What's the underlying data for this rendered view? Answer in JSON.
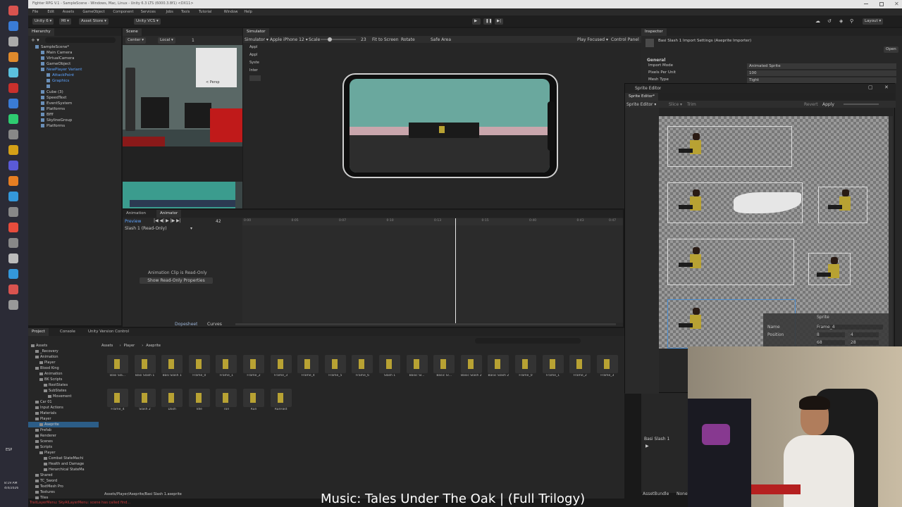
{
  "window": {
    "title": "Fighter RPG V.1 - SampleScene - Windows, Mac, Linux - Unity 6.3 LTS (6000.3.8f1) <DX11>"
  },
  "menubar": [
    "File",
    "Edit",
    "Assets",
    "GameObject",
    "Component",
    "Services",
    "Jobs",
    "Tools",
    "Tutorial",
    "Window",
    "Help"
  ],
  "toolbar": {
    "unity_label": "Unity 6",
    "account_label": "MI",
    "asset_store_label": "Asset Store",
    "vcs_label": "Unity VCS",
    "layout_label": "Layout"
  },
  "hierarchy": {
    "tab": "Hierarchy",
    "items": [
      {
        "label": "SampleScene*",
        "depth": 0,
        "expanded": true
      },
      {
        "label": "Main Camera",
        "depth": 1
      },
      {
        "label": "VirtualCamera",
        "depth": 1
      },
      {
        "label": "GameObject",
        "depth": 1
      },
      {
        "label": "NewPlayer Variant",
        "depth": 1,
        "expanded": true,
        "highlight": true
      },
      {
        "label": "AttackPoint",
        "depth": 2,
        "highlight": true
      },
      {
        "label": "Graphics",
        "depth": 2,
        "highlight": true
      },
      {
        "label": "",
        "depth": 2
      },
      {
        "label": "Cube (3)",
        "depth": 1
      },
      {
        "label": "SpeedText",
        "depth": 1
      },
      {
        "label": "EventSystem",
        "depth": 1
      },
      {
        "label": "Platforms",
        "depth": 1
      },
      {
        "label": "Bfff",
        "depth": 1
      },
      {
        "label": "SkylineGroup",
        "depth": 1
      },
      {
        "label": "Platforms",
        "depth": 1
      }
    ]
  },
  "scene": {
    "tab": "Scene",
    "center_label": "Center",
    "local_label": "Local",
    "persp_label": "< Persp",
    "count": "1"
  },
  "simulator": {
    "tab": "Simulator",
    "mode": "Simulator",
    "device": "Apple iPhone 12",
    "scale_label": "Scale",
    "scale_value": "23",
    "fit_label": "Fit to Screen",
    "rotate_label": "Rotate",
    "safe_area_label": "Safe Area",
    "play_mode": "Play Focused",
    "control_panel": "Control Panel",
    "side_items": [
      "Appl",
      "Appl",
      "Syste",
      "Inter"
    ]
  },
  "animation": {
    "tabs": [
      "Animation",
      "Animator"
    ],
    "preview_label": "Preview",
    "frame": "42",
    "clip": "Slash 1 (Read-Only)",
    "ruler": [
      "0:00",
      "0:05",
      "0:07",
      "0:10",
      "0:13",
      "0:15",
      "0:40",
      "0:43",
      "0:47"
    ],
    "readonly_text": "Animation Clip is Read-Only",
    "readonly_button": "Show Read-Only Properties",
    "bottom_tabs": [
      "Dopesheet",
      "Curves"
    ],
    "playhead_fraction": 0.56
  },
  "inspector": {
    "tab": "Inspector",
    "title": "Basi Slash 1 Import Settings (Aseprite Importer)",
    "open_button": "Open",
    "section": "General",
    "rows": [
      {
        "label": "Import Mode",
        "value": "Animated Sprite"
      },
      {
        "label": "Pixels Per Unit",
        "value": "100"
      },
      {
        "label": "Mesh Type",
        "value": "Tight"
      }
    ],
    "bottom_label": "Basi Slash 1",
    "bottom_tabs": [
      "AssetBundle",
      "None"
    ]
  },
  "sprite_editor": {
    "title": "Sprite Editor",
    "tab": "Sprite Editor*",
    "mode": "Sprite Editor",
    "slice_label": "Slice",
    "trim_label": "Trim",
    "revert_label": "Revert",
    "apply_label": "Apply",
    "popup": {
      "title": "Sprite",
      "name_label": "Name",
      "name_value": "Frame_4",
      "pos_label": "Position",
      "x": "8",
      "y": "4",
      "w": "68",
      "h": "28"
    }
  },
  "project": {
    "tabs": [
      "Project",
      "Console",
      "Unity Version Control"
    ],
    "breadcrumb": [
      "Assets",
      "Player",
      "Aseprite"
    ],
    "tree": [
      {
        "label": "Assets",
        "depth": 0
      },
      {
        "label": "_Recovery",
        "depth": 1
      },
      {
        "label": "Animation",
        "depth": 1
      },
      {
        "label": "Player",
        "depth": 2
      },
      {
        "label": "Blood King",
        "depth": 1
      },
      {
        "label": "Animation",
        "depth": 2
      },
      {
        "label": "BK Scripts",
        "depth": 2
      },
      {
        "label": "RootStates",
        "depth": 3
      },
      {
        "label": "SubStates",
        "depth": 3
      },
      {
        "label": "Movement",
        "depth": 4
      },
      {
        "label": "Car 01",
        "depth": 1
      },
      {
        "label": "Input Actions",
        "depth": 1
      },
      {
        "label": "Materials",
        "depth": 1
      },
      {
        "label": "Player",
        "depth": 1
      },
      {
        "label": "Aseprite",
        "depth": 2,
        "selected": true
      },
      {
        "label": "Prefab",
        "depth": 1
      },
      {
        "label": "Renderer",
        "depth": 1
      },
      {
        "label": "Scenes",
        "depth": 1
      },
      {
        "label": "Scripts",
        "depth": 1
      },
      {
        "label": "Player",
        "depth": 2
      },
      {
        "label": "Combat StateMachi",
        "depth": 3
      },
      {
        "label": "Health and Damage",
        "depth": 3
      },
      {
        "label": "Herarchical StateMa",
        "depth": 3
      },
      {
        "label": "Shared",
        "depth": 1
      },
      {
        "label": "TC_Sword",
        "depth": 1
      },
      {
        "label": "TextMesh Pro",
        "depth": 1
      },
      {
        "label": "Textures",
        "depth": 1
      },
      {
        "label": "Tiles",
        "depth": 1
      }
    ],
    "assets_row1": [
      "Basi Sla...",
      "Basi Slash 1",
      "Basi Slash 1",
      "Frame_0",
      "Frame_1",
      "Frame_2",
      "Frame_3",
      "Frame_4",
      "Frame_5",
      "Frame_6",
      "Slash 1",
      "Basic Sl...",
      "Basic Sl...",
      "Basic Slash 2",
      "Basic Slash 2",
      "Frame_0",
      "Frame_1",
      "Frame_2",
      "Frame_3"
    ],
    "assets_row2": [
      "Frame_4",
      "Slash 2",
      "Dash",
      "Idle",
      "roll",
      "Run",
      "RunFast"
    ],
    "footer_path": "Assets/Player/Aseprite/Basi Slash 1.aseprite"
  },
  "status_bar": {
    "error": "TrailLayerMenu: SkyAILayerMenu: scene has called find..."
  },
  "caption": "Music: Tales Under The Oak | (Full Trilogy)",
  "taskbar": {
    "lang": "ESP",
    "time": "8:19 AM",
    "date": "4/4/2026"
  },
  "colors": {
    "accent": "#3d6fa8",
    "selection": "#2c5d87",
    "panel": "#2a2a2a",
    "error": "#c83c3c",
    "blue_text": "#5da3ff"
  }
}
